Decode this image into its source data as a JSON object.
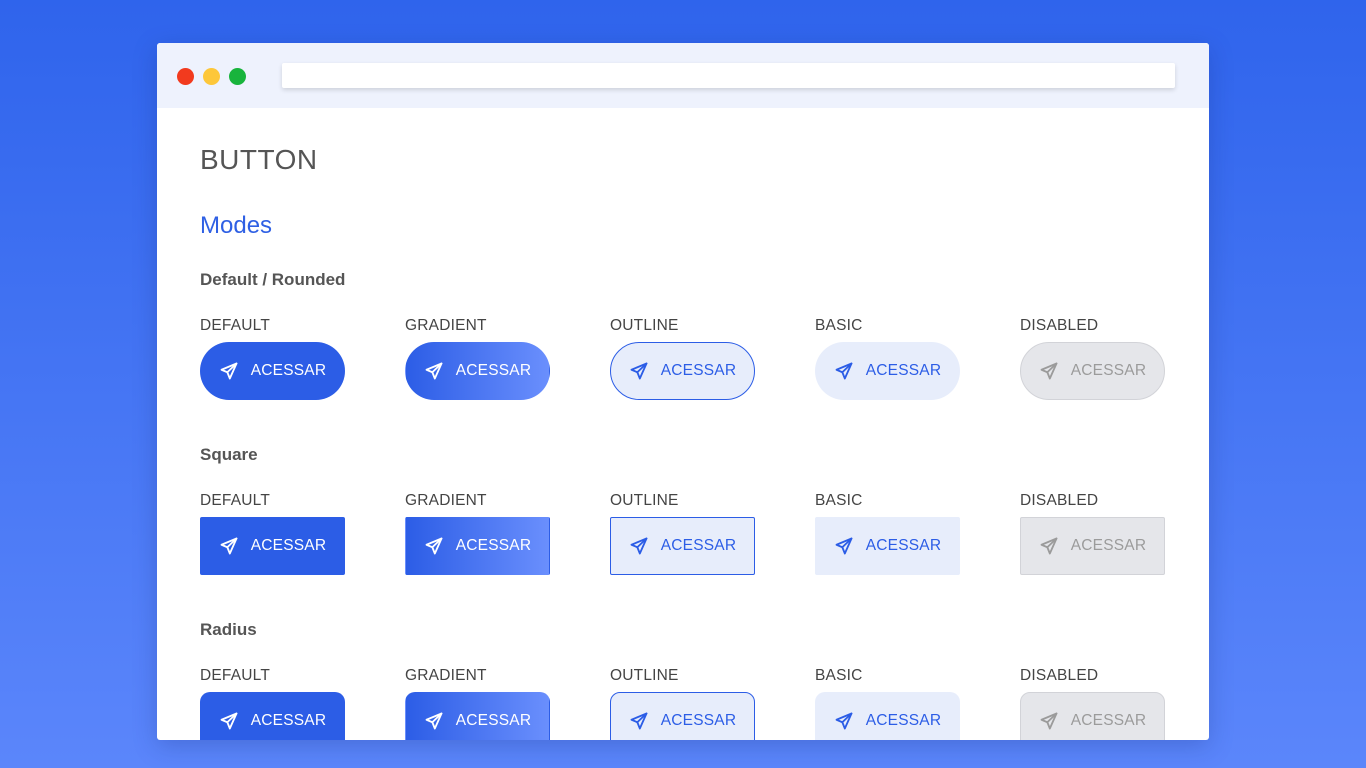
{
  "page": {
    "title": "BUTTON",
    "section": "Modes"
  },
  "colors": {
    "primary": "#2c5de6",
    "basic_bg": "#e7edfb",
    "disabled_bg": "#e5e6ea",
    "disabled_text": "#9b9b9b",
    "background_top": "#2f64ec",
    "background_bottom": "#5b86fb"
  },
  "icon": "paper-plane-icon",
  "groups": [
    {
      "title": "Default / Rounded",
      "cells": [
        {
          "label": "DEFAULT",
          "button": "ACESSAR"
        },
        {
          "label": "GRADIENT",
          "button": "ACESSAR"
        },
        {
          "label": "OUTLINE",
          "button": "ACESSAR"
        },
        {
          "label": "BASIC",
          "button": "ACESSAR"
        },
        {
          "label": "DISABLED",
          "button": "ACESSAR"
        }
      ]
    },
    {
      "title": "Square",
      "cells": [
        {
          "label": "DEFAULT",
          "button": "ACESSAR"
        },
        {
          "label": "GRADIENT",
          "button": "ACESSAR"
        },
        {
          "label": "OUTLINE",
          "button": "ACESSAR"
        },
        {
          "label": "BASIC",
          "button": "ACESSAR"
        },
        {
          "label": "DISABLED",
          "button": "ACESSAR"
        }
      ]
    },
    {
      "title": "Radius",
      "cells": [
        {
          "label": "DEFAULT",
          "button": "ACESSAR"
        },
        {
          "label": "GRADIENT",
          "button": "ACESSAR"
        },
        {
          "label": "OUTLINE",
          "button": "ACESSAR"
        },
        {
          "label": "BASIC",
          "button": "ACESSAR"
        },
        {
          "label": "DISABLED",
          "button": "ACESSAR"
        }
      ]
    }
  ]
}
